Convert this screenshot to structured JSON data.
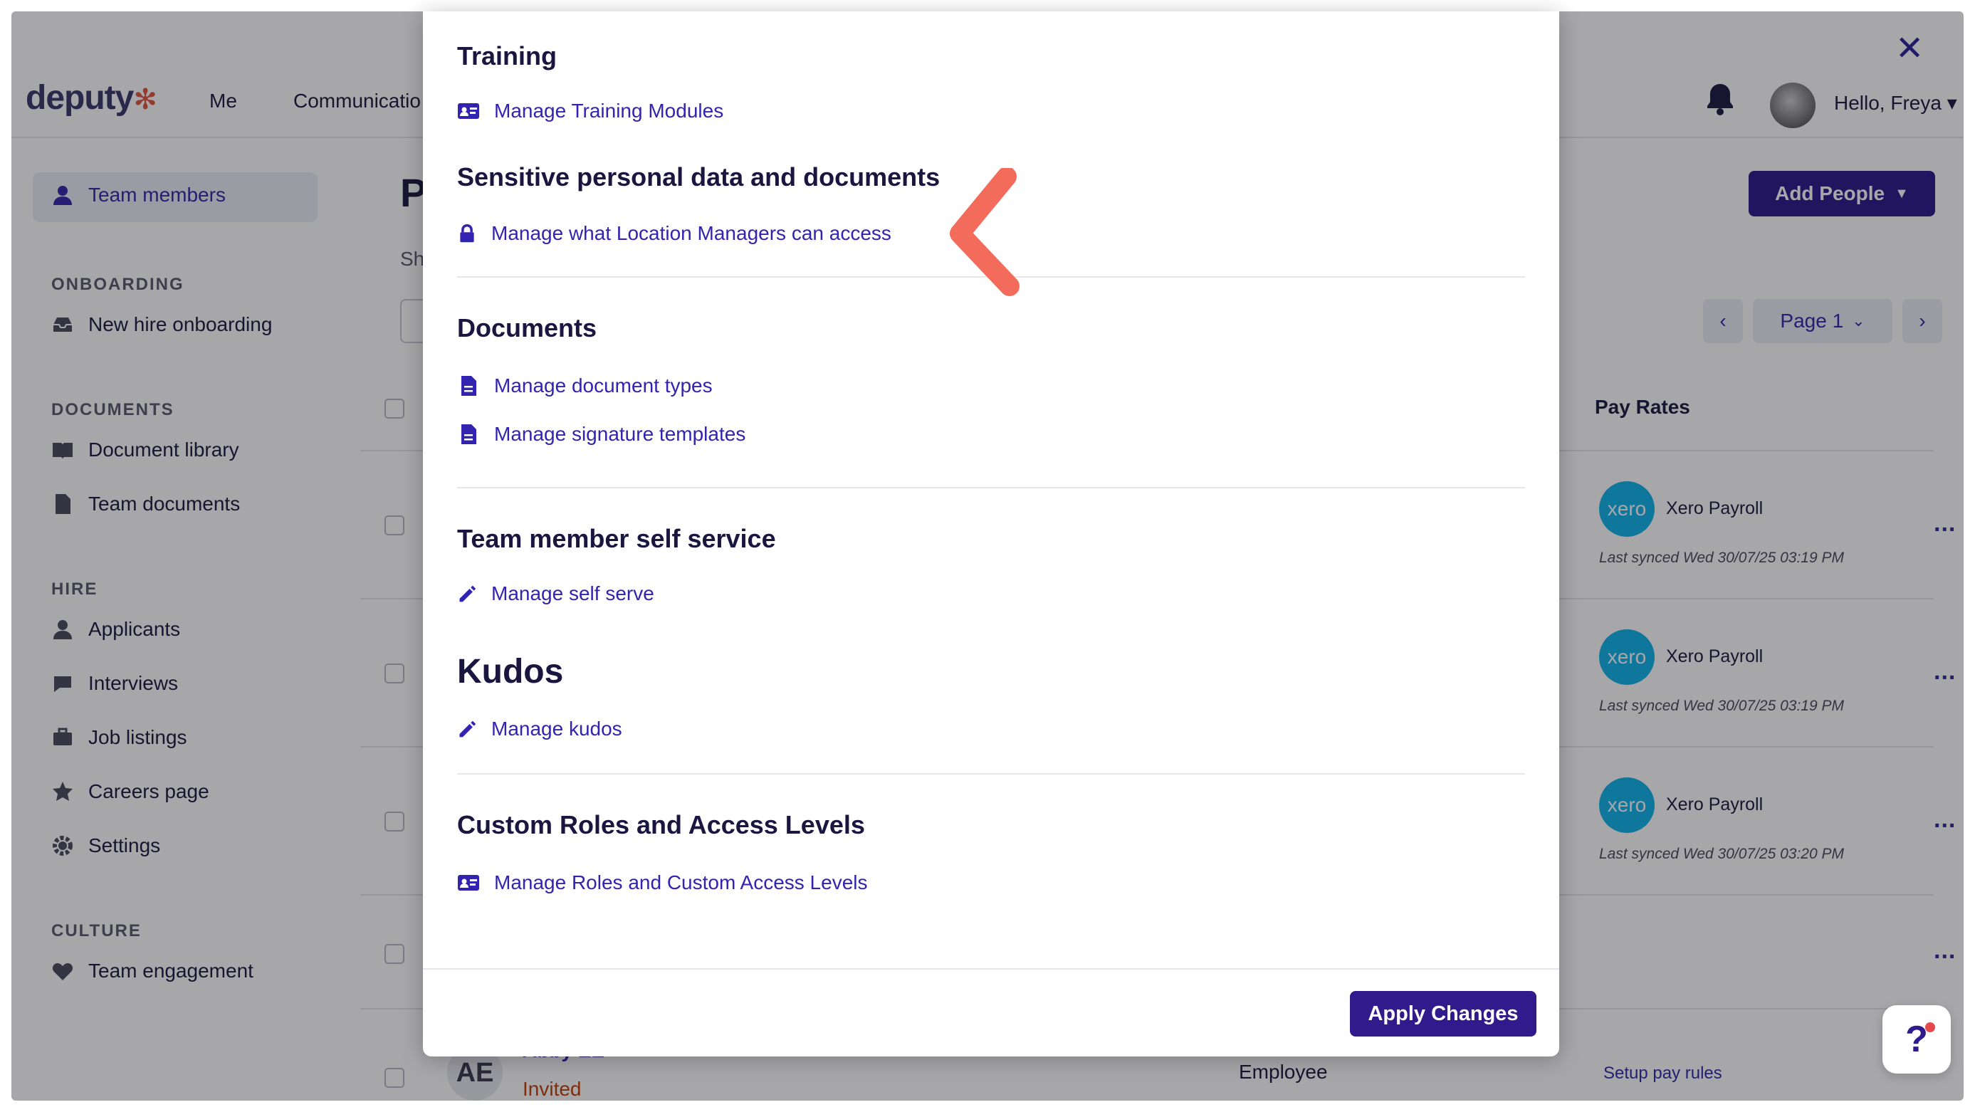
{
  "app": {
    "logo": "deputy",
    "nav": [
      "Me",
      "Communicatio"
    ],
    "greeting": "Hello, Freya"
  },
  "sidebar": {
    "active_item": "Team members",
    "sections": [
      {
        "heading": "ONBOARDING",
        "items": [
          "New hire onboarding"
        ]
      },
      {
        "heading": "DOCUMENTS",
        "items": [
          "Document library",
          "Team documents"
        ]
      },
      {
        "heading": "HIRE",
        "items": [
          "Applicants",
          "Interviews",
          "Job listings",
          "Careers page",
          "Settings"
        ]
      },
      {
        "heading": "CULTURE",
        "items": [
          "Team engagement"
        ]
      }
    ]
  },
  "background": {
    "page_title_fragment": "P",
    "sub_fragment": "Sh",
    "add_people": "Add People",
    "pager_label": "Page 1",
    "pay_rates_header": "Pay Rates",
    "xero_logo_text": "xero",
    "rows": [
      {
        "payroll": "Xero Payroll",
        "synced": "Last synced Wed 30/07/25 03:19 PM"
      },
      {
        "payroll": "Xero Payroll",
        "synced": "Last synced Wed 30/07/25 03:19 PM"
      },
      {
        "payroll": "Xero Payroll",
        "synced": "Last synced Wed 30/07/25 03:20 PM"
      }
    ],
    "last_row": {
      "initials": "AE",
      "name": "Abby EE",
      "status": "Invited",
      "role": "Employee",
      "pay": "Setup pay rules"
    },
    "more_label": "..."
  },
  "modal": {
    "close_label": "✕",
    "sections": [
      {
        "title": "Training",
        "links": [
          "Manage Training Modules"
        ]
      },
      {
        "title": "Sensitive personal data and documents",
        "links": [
          "Manage what Location Managers can access"
        ]
      },
      {
        "title": "Documents",
        "links": [
          "Manage document types",
          "Manage signature templates"
        ]
      },
      {
        "title": "Team member self service",
        "links": [
          "Manage self serve"
        ]
      },
      {
        "title": "Kudos",
        "links": [
          "Manage kudos"
        ]
      },
      {
        "title": "Custom Roles and Access Levels",
        "links": [
          "Manage Roles and Custom Access Levels"
        ]
      }
    ],
    "apply_label": "Apply Changes"
  },
  "help": {
    "label": "?"
  },
  "colors": {
    "brand": "#2f1b8c",
    "link": "#3223b0",
    "annotation": "#f26b5b"
  }
}
